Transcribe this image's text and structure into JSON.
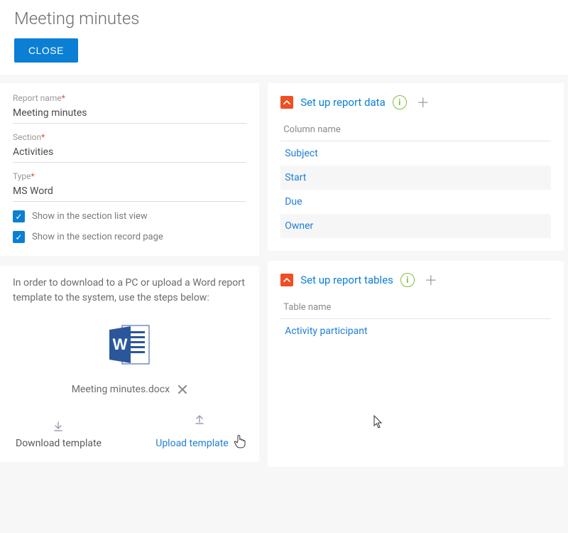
{
  "header": {
    "title": "Meeting minutes",
    "close_label": "CLOSE"
  },
  "form": {
    "report_name": {
      "label": "Report name",
      "value": "Meeting minutes",
      "required": true
    },
    "section": {
      "label": "Section",
      "value": "Activities",
      "required": true
    },
    "type": {
      "label": "Type",
      "value": "MS Word",
      "required": true
    },
    "show_list": {
      "label": "Show in the section list view",
      "checked": true
    },
    "show_record": {
      "label": "Show in the section record page",
      "checked": true
    }
  },
  "template": {
    "instruction": "In order to download to a PC or upload a Word report template to the system, use the steps below:",
    "file_name": "Meeting minutes.docx",
    "download_label": "Download template",
    "upload_label": "Upload template"
  },
  "report_data": {
    "section_title": "Set up report data",
    "column_header": "Column name",
    "rows": [
      "Subject",
      "Start",
      "Due",
      "Owner"
    ]
  },
  "report_tables": {
    "section_title": "Set up report tables",
    "column_header": "Table name",
    "rows": [
      "Activity participant"
    ]
  },
  "colors": {
    "primary": "#0b7fd4",
    "accent": "#f04e23",
    "success": "#7fbf3f"
  }
}
